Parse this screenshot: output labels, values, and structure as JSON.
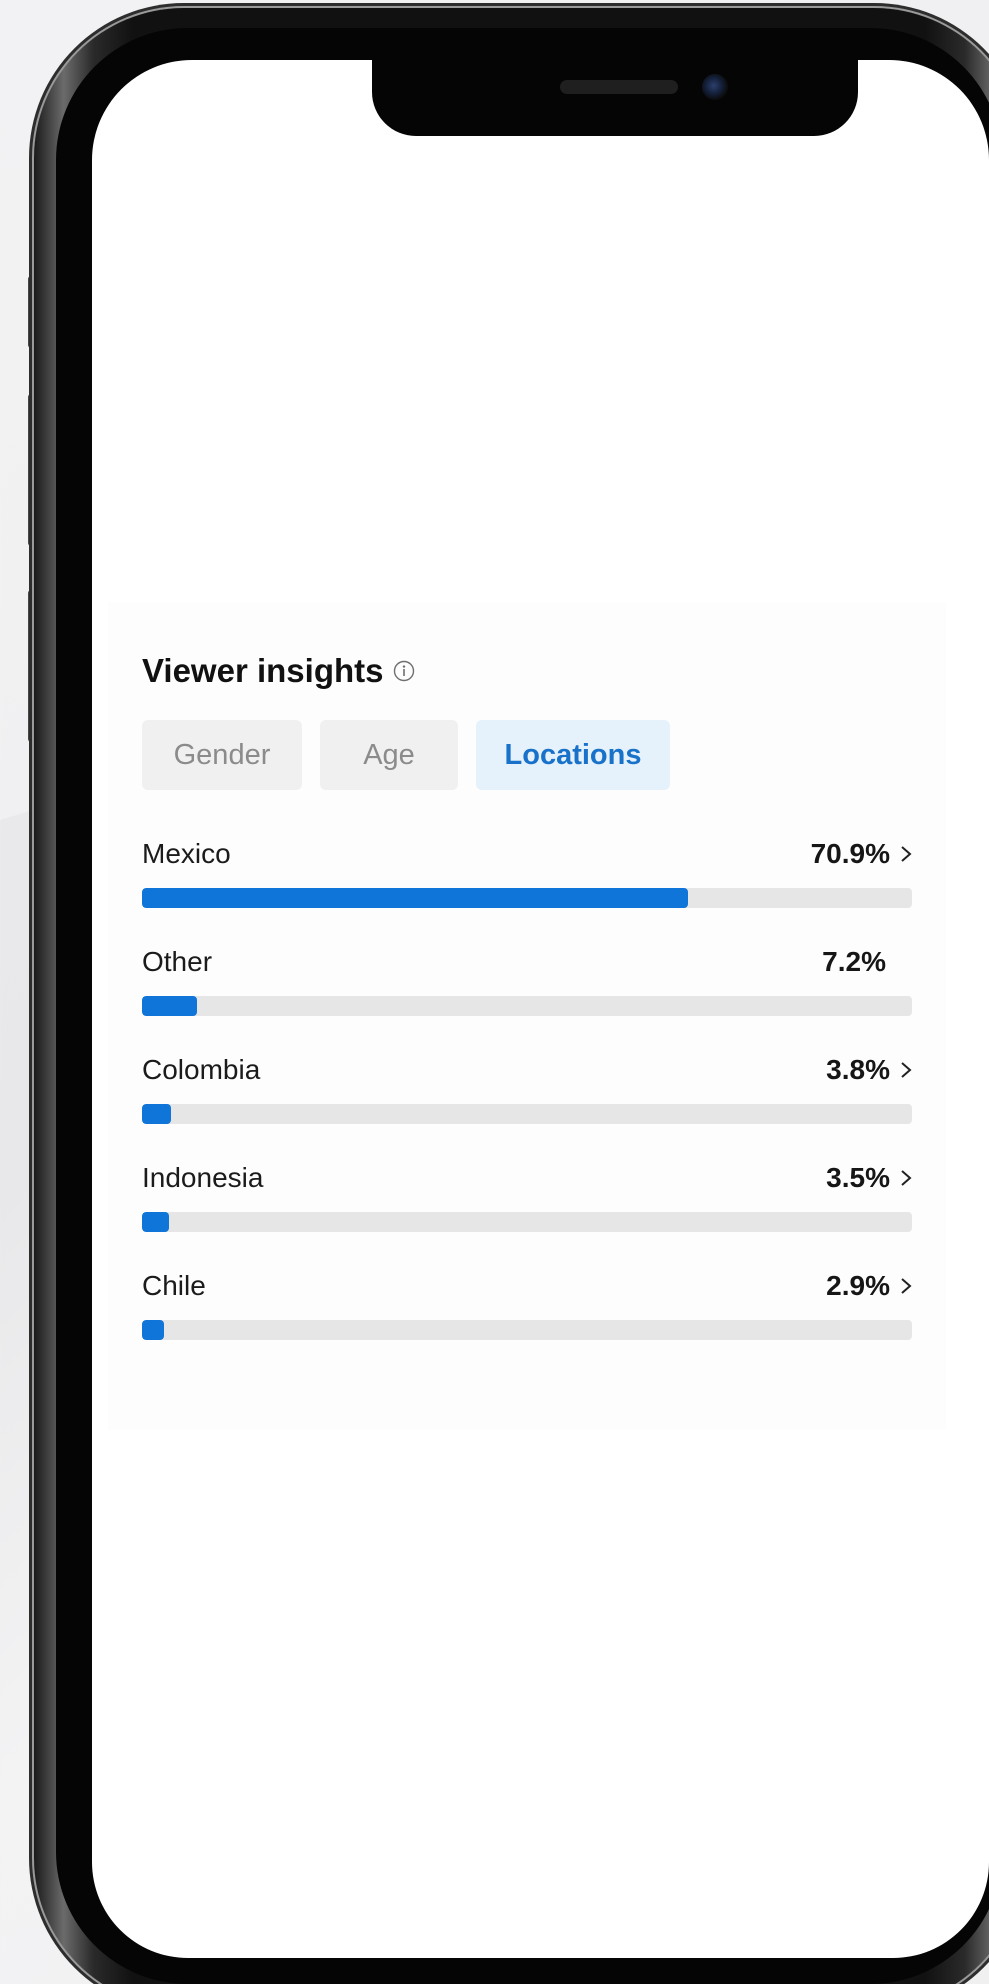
{
  "card": {
    "title": "Viewer insights",
    "info_icon": "info-icon",
    "tabs": [
      {
        "label": "Gender",
        "active": false
      },
      {
        "label": "Age",
        "active": false
      },
      {
        "label": "Locations",
        "active": true
      }
    ],
    "rows": [
      {
        "label": "Mexico",
        "value": "70.9%",
        "fraction": 0.709,
        "chevron": true
      },
      {
        "label": "Other",
        "value": "7.2%",
        "fraction": 0.072,
        "chevron": false
      },
      {
        "label": "Colombia",
        "value": "3.8%",
        "fraction": 0.038,
        "chevron": true
      },
      {
        "label": "Indonesia",
        "value": "3.5%",
        "fraction": 0.035,
        "chevron": true
      },
      {
        "label": "Chile",
        "value": "2.9%",
        "fraction": 0.029,
        "chevron": true
      }
    ]
  },
  "colors": {
    "accent": "#0f75d9",
    "active_tab_bg": "#e5f1fb",
    "active_tab_text": "#1872c9",
    "track": "#e6e6e6"
  }
}
